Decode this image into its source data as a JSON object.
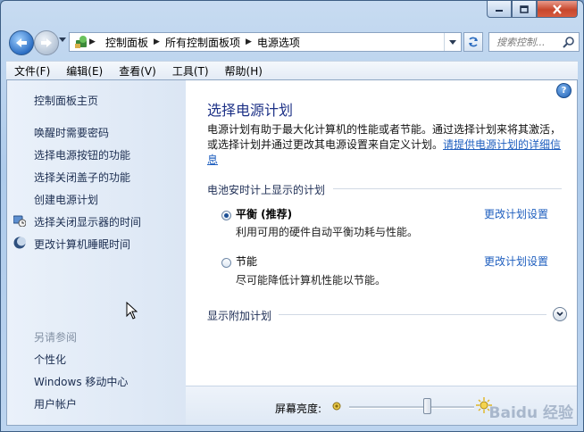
{
  "window": {
    "caption_icons": [
      "minimize-icon",
      "maximize-icon",
      "close-icon"
    ]
  },
  "address": {
    "crumbs": [
      "控制面板",
      "所有控制面板项",
      "电源选项"
    ],
    "search_placeholder": "搜索控制..."
  },
  "menu": [
    "文件(F)",
    "编辑(E)",
    "查看(V)",
    "工具(T)",
    "帮助(H)"
  ],
  "sidebar": {
    "home": "控制面板主页",
    "links": [
      "唤醒时需要密码",
      "选择电源按钮的功能",
      "选择关闭盖子的功能",
      "创建电源计划"
    ],
    "icon_links": [
      "选择关闭显示器的时间",
      "更改计算机睡眠时间"
    ],
    "see_also_title": "另请参阅",
    "see_also": [
      "个性化",
      "Windows 移动中心",
      "用户帐户"
    ]
  },
  "main": {
    "help": "?",
    "title": "选择电源计划",
    "desc_text": "电源计划有助于最大化计算机的性能或者节能。通过选择计划来将其激活，或选择计划并通过更改其电源设置来自定义计划。",
    "desc_link": "请提供电源计划的详细信息",
    "group_label": "电池安时计上显示的计划",
    "plans": [
      {
        "name": "平衡 (推荐)",
        "desc": "利用可用的硬件自动平衡功耗与性能。",
        "selected": true,
        "change": "更改计划设置"
      },
      {
        "name": "节能",
        "desc": "尽可能降低计算机性能以节能。",
        "selected": false,
        "change": "更改计划设置"
      }
    ],
    "additional": "显示附加计划",
    "brightness_label": "屏幕亮度:",
    "brightness_level": 0.62
  },
  "watermark": "Baidu 经验"
}
